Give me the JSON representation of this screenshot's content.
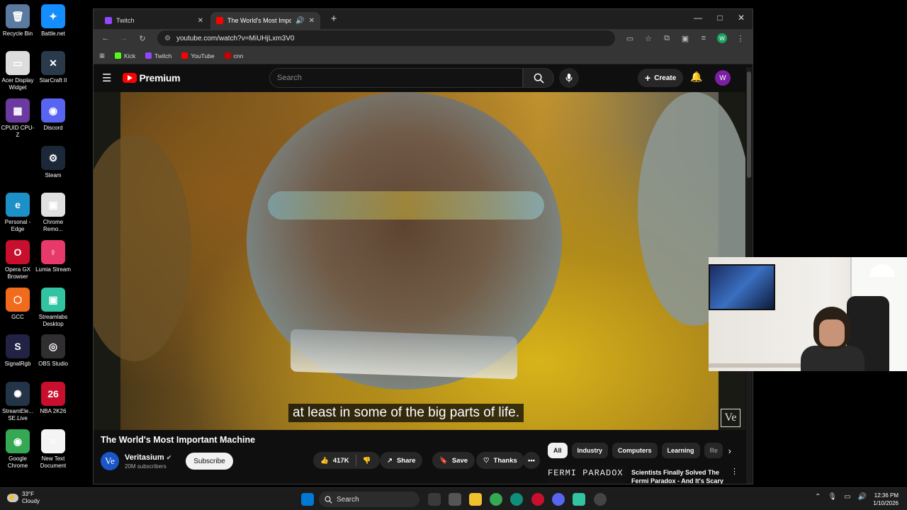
{
  "desktop": {
    "icons": [
      {
        "label": "Recycle Bin",
        "color": "#5a7aa0",
        "glyph": "🗑"
      },
      {
        "label": "Battle.net",
        "color": "#148eff",
        "glyph": "✦"
      },
      {
        "label": "Acer Display Widget",
        "color": "#dddddd",
        "glyph": "▭"
      },
      {
        "label": "StarCraft II",
        "color": "#2a3a4a",
        "glyph": "✕"
      },
      {
        "label": "CPUID CPU-Z",
        "color": "#6a3aa0",
        "glyph": "▦"
      },
      {
        "label": "Discord",
        "color": "#5865f2",
        "glyph": "◉"
      },
      {
        "label": "Steam",
        "color": "#1b2838",
        "glyph": "⚙"
      },
      {
        "label": "Personal - Edge",
        "color": "#1e90c8",
        "glyph": "e"
      },
      {
        "label": "Chrome Remo...",
        "color": "#e0e0e0",
        "glyph": "▣"
      },
      {
        "label": "Opera GX Browser",
        "color": "#c8102e",
        "glyph": "O"
      },
      {
        "label": "Lumia Stream",
        "color": "#e83a6a",
        "glyph": "♀"
      },
      {
        "label": "GCC",
        "color": "#f26a1b",
        "glyph": "⬡"
      },
      {
        "label": "Streamlabs Desktop",
        "color": "#31c3a2",
        "glyph": "▣"
      },
      {
        "label": "SignalRgb",
        "color": "#222244",
        "glyph": "S"
      },
      {
        "label": "OBS Studio",
        "color": "#302e31",
        "glyph": "◎"
      },
      {
        "label": "StreamEle... SE.Live",
        "color": "#243448",
        "glyph": "✺"
      },
      {
        "label": "NBA 2K26",
        "color": "#c8102e",
        "glyph": "26"
      },
      {
        "label": "Google Chrome",
        "color": "#34a853",
        "glyph": "◉"
      },
      {
        "label": "New Text Document",
        "color": "#f4f4f4",
        "glyph": "≡"
      }
    ]
  },
  "browser": {
    "tabs": [
      {
        "title": "Twitch",
        "favicon_color": "#9146ff"
      },
      {
        "title": "The World's Most Importan",
        "favicon_color": "#ff0000"
      }
    ],
    "new_tab_icon": "plus-icon",
    "window_controls": {
      "minimize": "—",
      "maximize": "□",
      "close": "✕"
    },
    "url": "youtube.com/watch?v=MiUHjLxm3V0",
    "bookmarks": [
      {
        "label": "Kick",
        "color": "#53fc18"
      },
      {
        "label": "Twitch",
        "color": "#9146ff"
      },
      {
        "label": "YouTube",
        "color": "#ff0000"
      },
      {
        "label": "cnn",
        "color": "#cc0000"
      }
    ],
    "profile_initial": "W"
  },
  "youtube": {
    "logo_text": "Premium",
    "search_placeholder": "Search",
    "create_label": "Create",
    "avatar_initial": "W",
    "caption": "at least in some of the big parts of life.",
    "watermark": "Ve",
    "video_title": "The World's Most Important Machine",
    "channel": {
      "name": "Veritasium",
      "subscribers": "20M subscribers",
      "avatar_text": "Ve"
    },
    "subscribe_label": "Subscribe",
    "likes": "417K",
    "share_label": "Share",
    "save_label": "Save",
    "thanks_label": "Thanks",
    "chips": [
      "All",
      "Industry",
      "Computers",
      "Learning",
      "Re"
    ],
    "recommendation": {
      "thumb_text": "FERMI PARADOX",
      "title": "Scientists Finally Solved The Fermi Paradox - And It's Scary"
    }
  },
  "taskbar": {
    "weather": {
      "temp": "33°F",
      "condition": "Cloudy"
    },
    "search_label": "Search",
    "time": "12:36 PM",
    "date": "1/10/2026"
  }
}
